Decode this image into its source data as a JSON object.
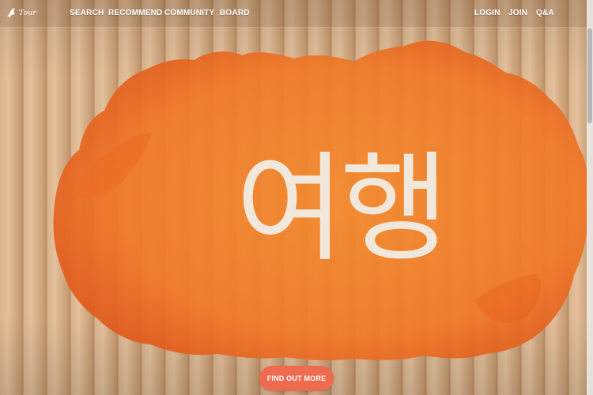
{
  "nav": {
    "logo_text": "Tour",
    "left_items": [
      "SEARCH",
      "RECOMMEND",
      "COMMUNITY",
      "BOARD"
    ],
    "right_items": [
      "LOGIN",
      "JOIN",
      "Q&A"
    ]
  },
  "hero": {
    "title": "여행",
    "cta_label": "FIND OUT MORE"
  },
  "colors": {
    "accent": "#ef6b4f",
    "blob": "#f07a28",
    "title_text": "#f1e7da"
  }
}
